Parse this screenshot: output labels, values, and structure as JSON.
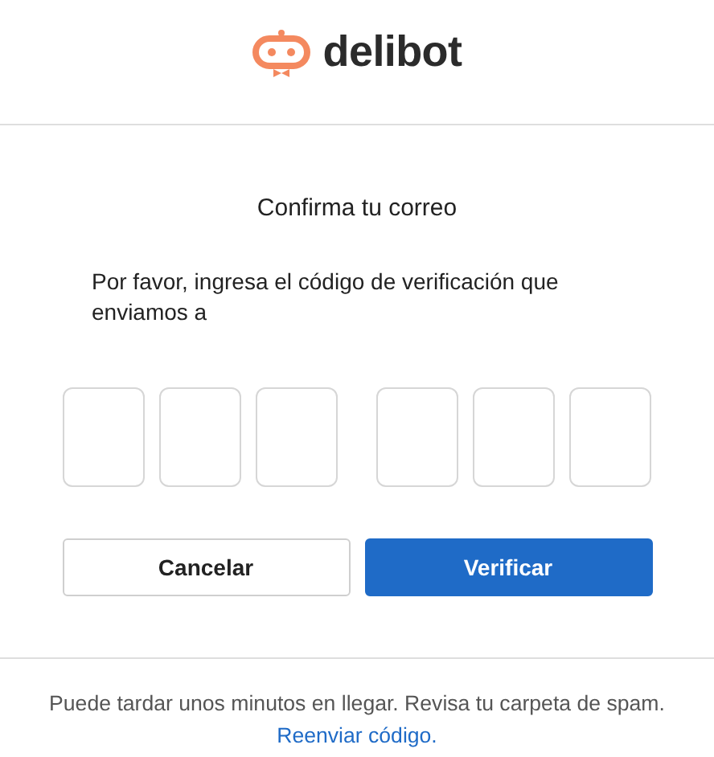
{
  "brand": {
    "name": "delibot"
  },
  "title": "Confirma tu correo",
  "message": "Por favor, ingresa el código de verificación que enviamos a",
  "code_groups": [
    [
      {
        "kind": "digit"
      },
      {
        "kind": "digit"
      },
      {
        "kind": "digit"
      }
    ],
    [
      {
        "kind": "digit"
      },
      {
        "kind": "digit"
      },
      {
        "kind": "digit"
      }
    ]
  ],
  "buttons": [
    {
      "label": "Cancelar",
      "kind": "secondary"
    },
    {
      "label": "Verificar",
      "kind": "primary"
    }
  ],
  "footer": {
    "text": "Puede tardar unos minutos en llegar. Revisa tu carpeta de spam.",
    "link": "Reenviar código."
  }
}
